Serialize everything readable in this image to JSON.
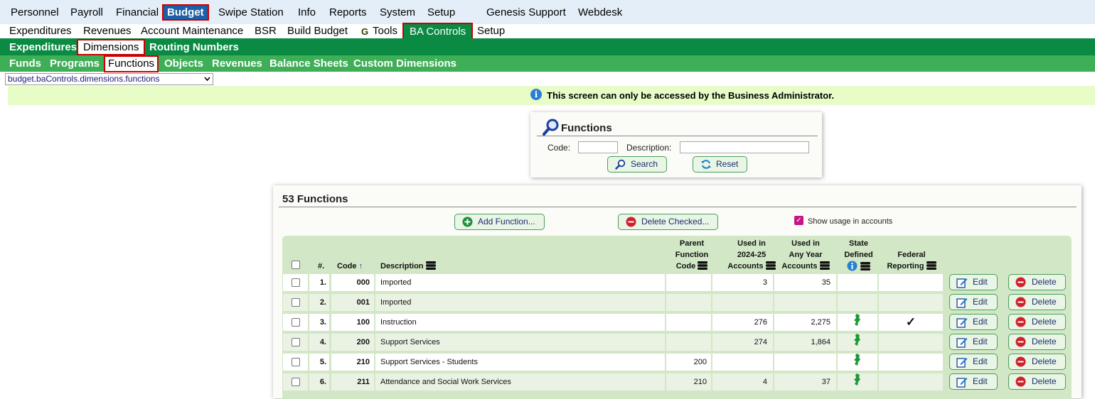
{
  "topnav": [
    "Personnel",
    "Payroll",
    "Financial",
    "Budget",
    "Swipe Station",
    "Info",
    "Reports",
    "System",
    "Setup",
    "Genesis Support",
    "Webdesk"
  ],
  "subnav": [
    "Expenditures",
    "Revenues",
    "Account Maintenance",
    "BSR",
    "Build Budget",
    "Tools",
    "BA Controls",
    "Setup"
  ],
  "dimnav": [
    "Expenditures",
    "Dimensions",
    "Routing Numbers"
  ],
  "funnav": [
    "Funds",
    "Programs",
    "Functions",
    "Objects",
    "Revenues",
    "Balance Sheets",
    "Custom Dimensions"
  ],
  "path_select": "budget.baControls.dimensions.functions",
  "info_message": "This screen can only be accessed by the Business Administrator.",
  "search": {
    "title": "Functions",
    "code_label": "Code:",
    "description_label": "Description:",
    "code_value": "",
    "description_value": "",
    "search_label": "Search",
    "reset_label": "Reset"
  },
  "list": {
    "title": "53 Functions",
    "add_label": "Add Function...",
    "delete_label": "Delete Checked...",
    "usage_label": "Show usage in accounts",
    "usage_checked": true
  },
  "headers": {
    "num": "#.",
    "code": "Code",
    "code_sort": "↑",
    "description": "Description",
    "parent": [
      "Parent",
      "Function",
      "Code"
    ],
    "used_year": [
      "Used in",
      "2024-25",
      "Accounts"
    ],
    "used_any": [
      "Used in",
      "Any Year",
      "Accounts"
    ],
    "state": [
      "State",
      "Defined"
    ],
    "federal": [
      "Federal",
      "Reporting"
    ]
  },
  "rows": [
    {
      "num": "1.",
      "code": "000",
      "description": "Imported",
      "parent": "",
      "used_year": "3",
      "used_any": "35",
      "state": false,
      "federal": false
    },
    {
      "num": "2.",
      "code": "001",
      "description": "Imported",
      "parent": "",
      "used_year": "",
      "used_any": "",
      "state": false,
      "federal": false
    },
    {
      "num": "3.",
      "code": "100",
      "description": "Instruction",
      "parent": "",
      "used_year": "276",
      "used_any": "2,275",
      "state": true,
      "federal": true
    },
    {
      "num": "4.",
      "code": "200",
      "description": "Support Services",
      "parent": "",
      "used_year": "274",
      "used_any": "1,864",
      "state": true,
      "federal": false
    },
    {
      "num": "5.",
      "code": "210",
      "description": "Support Services - Students",
      "parent": "200",
      "used_year": "",
      "used_any": "",
      "state": true,
      "federal": false
    },
    {
      "num": "6.",
      "code": "211",
      "description": "Attendance and Social Work Services",
      "parent": "210",
      "used_year": "4",
      "used_any": "37",
      "state": true,
      "federal": false
    }
  ],
  "edit_label": "Edit",
  "delete_row_label": "Delete",
  "federal_check": "✓",
  "colors": {
    "top_bg": "#e3eef8",
    "dim_green": "#0b8a43",
    "fun_green": "#3eae57",
    "info_bg": "#e8fcc8",
    "table_head": "#d2e7c5",
    "selected_outline": "#cc0000"
  }
}
